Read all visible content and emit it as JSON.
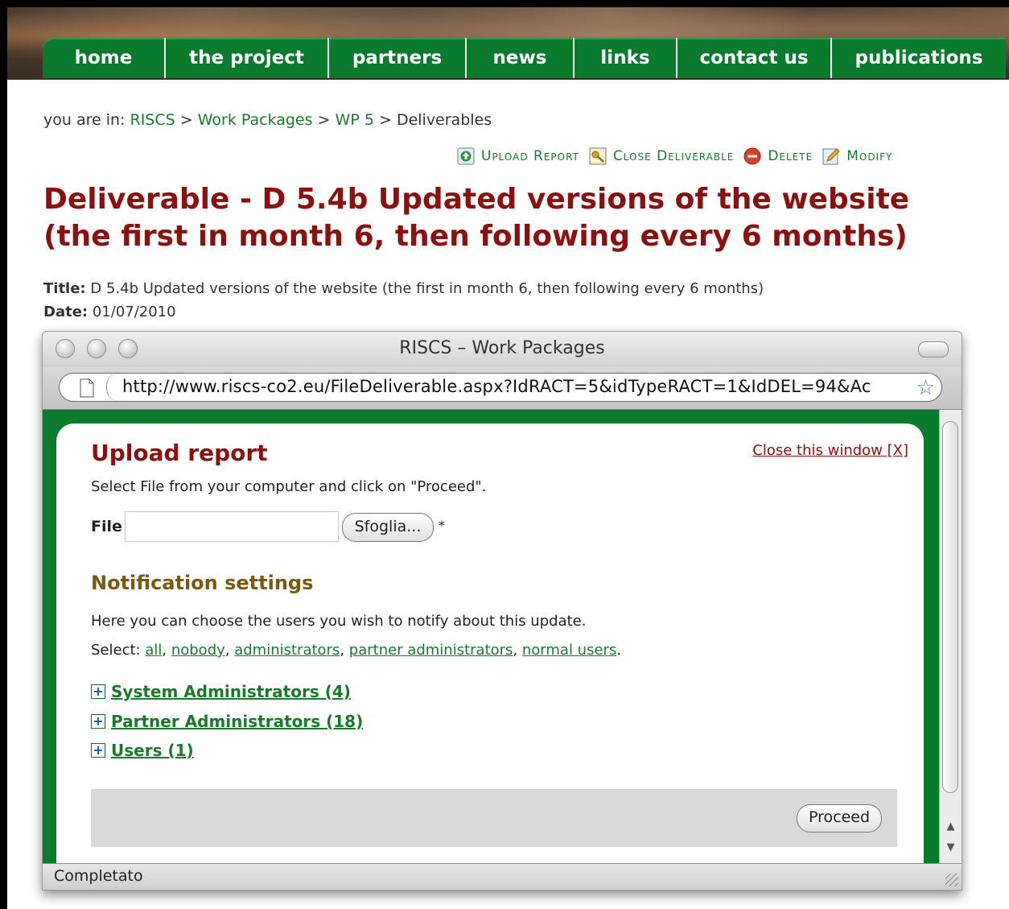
{
  "nav": {
    "items": [
      {
        "label": "home"
      },
      {
        "label": "the project"
      },
      {
        "label": "partners"
      },
      {
        "label": "news"
      },
      {
        "label": "links"
      },
      {
        "label": "contact us"
      },
      {
        "label": "publications"
      }
    ]
  },
  "breadcrumb": {
    "prefix": "you are in:",
    "items": [
      "RISCS",
      "Work Packages",
      "WP 5",
      "Deliverables"
    ],
    "separator": ">"
  },
  "actions": {
    "upload": "Upload Report",
    "close": "Close Deliverable",
    "delete": "Delete",
    "modify": "Modify"
  },
  "deliverable": {
    "heading": "Deliverable  - D 5.4b Updated versions of the website (the first in month 6, then following every 6 months)",
    "title_label": "Title:",
    "title_value": "D 5.4b Updated versions of the website (the first in month 6, then following every 6 months)",
    "date_label": "Date:",
    "date_value": "01/07/2010"
  },
  "popup": {
    "window_title": "RISCS – Work Packages",
    "url": "http://www.riscs-co2.eu/FileDeliverable.aspx?IdRACT=5&idTypeRACT=1&IdDEL=94&Ac",
    "status": "Completato",
    "upload_title": "Upload report",
    "close_link": "Close this window [X]",
    "instructions": "Select File from your computer and click on \"Proceed\".",
    "file_label": "File",
    "browse_button": "Sfoglia...",
    "required_mark": "*",
    "notification_title": "Notification settings",
    "notification_text": "Here you can choose the users you wish to notify about this update.",
    "select_label": "Select:",
    "select_links": [
      "all",
      "nobody",
      "administrators",
      "partner administrators",
      "normal users"
    ],
    "groups": [
      {
        "label": "System Administrators (4)"
      },
      {
        "label": "Partner Administrators (18)"
      },
      {
        "label": "Users (1)"
      }
    ],
    "proceed_button": "Proceed"
  },
  "colors": {
    "nav_green": "#0a7a2c",
    "heading_red": "#8b1010",
    "link_green": "#1a7a2c",
    "notification_brown": "#7a5a10"
  }
}
